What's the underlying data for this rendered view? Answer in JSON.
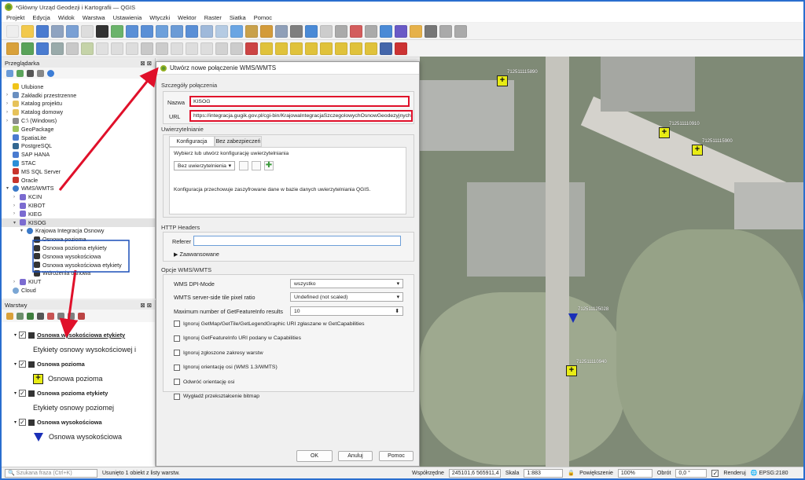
{
  "window": {
    "title": "*Główny Urząd Geodezji i Kartografii — QGIS"
  },
  "menu": [
    "Projekt",
    "Edycja",
    "Widok",
    "Warstwa",
    "Ustawienia",
    "Wtyczki",
    "Wektor",
    "Raster",
    "Siatka",
    "Pomoc"
  ],
  "browser": {
    "title": "Przeglądarka",
    "items": [
      {
        "label": "Ulubione",
        "icon": "star-icon",
        "indent": 0
      },
      {
        "label": "Zakładki przestrzenne",
        "icon": "bookmark-icon",
        "indent": 0
      },
      {
        "label": "Katalog projektu",
        "icon": "folder-icon",
        "indent": 0
      },
      {
        "label": "Katalog domowy",
        "icon": "folder-icon",
        "indent": 0
      },
      {
        "label": "C:\\ (Windows)",
        "icon": "drive-icon",
        "indent": 0
      },
      {
        "label": "GeoPackage",
        "icon": "geopackage-icon",
        "indent": 0
      },
      {
        "label": "SpatiaLite",
        "icon": "spatialite-icon",
        "indent": 0
      },
      {
        "label": "PostgreSQL",
        "icon": "postgresql-icon",
        "indent": 0
      },
      {
        "label": "SAP HANA",
        "icon": "database-icon",
        "indent": 0
      },
      {
        "label": "STAC",
        "icon": "stac-icon",
        "indent": 0
      },
      {
        "label": "MS SQL Server",
        "icon": "mssql-icon",
        "indent": 0
      },
      {
        "label": "Oracle",
        "icon": "oracle-icon",
        "indent": 0
      },
      {
        "label": "WMS/WMTS",
        "icon": "globe-icon",
        "indent": 0
      },
      {
        "label": "KCIN",
        "icon": "wms-connection-icon",
        "indent": 1
      },
      {
        "label": "KIBOT",
        "icon": "wms-connection-icon",
        "indent": 1
      },
      {
        "label": "KIEG",
        "icon": "wms-connection-icon",
        "indent": 1
      },
      {
        "label": "KISOG",
        "icon": "wms-connection-icon",
        "indent": 1
      },
      {
        "label": "Krajowa Integracja Osnowy",
        "icon": "globe-icon",
        "indent": 2
      },
      {
        "label": "Osnowa pozioma",
        "icon": "layer-icon",
        "indent": 3
      },
      {
        "label": "Osnowa pozioma etykiety",
        "icon": "layer-icon",
        "indent": 3
      },
      {
        "label": "Osnowa wysokościowa",
        "icon": "layer-icon",
        "indent": 3
      },
      {
        "label": "Osnowa wysokościowa etykiety",
        "icon": "layer-icon",
        "indent": 3
      },
      {
        "label": "Wdrożenia osnowa",
        "icon": "layer-icon",
        "indent": 3
      },
      {
        "label": "KIUT",
        "icon": "wms-connection-icon",
        "indent": 1
      },
      {
        "label": "Cloud",
        "icon": "cloud-icon",
        "indent": 0
      }
    ]
  },
  "layers": {
    "title": "Warstwy",
    "items": [
      {
        "name": "Osnowa wysokościowa etykiety",
        "legend": "Etykiety osnowy wysokościowej i",
        "symbol": "none"
      },
      {
        "name": "Osnowa pozioma",
        "legend": "Osnowa pozioma",
        "symbol": "yellow-square"
      },
      {
        "name": "Osnowa pozioma etykiety",
        "legend": "Etykiety osnowy poziomej",
        "symbol": "none"
      },
      {
        "name": "Osnowa wysokościowa",
        "legend": "Osnowa wysokościowa",
        "symbol": "blue-triangle"
      }
    ]
  },
  "dialog": {
    "title": "Utwórz nowe połączenie WMS/WMTS",
    "section_connection": "Szczegóły połączenia",
    "name_label": "Nazwa",
    "name_value": "KISOG",
    "url_label": "URL",
    "url_value": "https://integracja.gugik.gov.pl/cgi-bin/KrajowaIntegracjaSzczegolowychOsnowGeodezyjnych",
    "auth_section": "Uwierzytelnianie",
    "tab_config": "Konfiguracja",
    "tab_none": "Bez zabezpieczeń",
    "auth_prompt": "Wybierz lub utwórz konfigurację uwierzytelniania",
    "auth_combo": "Bez uwierzytelnienia",
    "auth_note": "Konfiguracja przechowuje zaszyfrowane dane w bazie danych uwierzytelniania QGIS.",
    "http_section": "HTTP Headers",
    "referer_label": "Referer",
    "advanced_label": "Zaawansowane",
    "options_section": "Opcje WMS/WMTS",
    "dpi_label": "WMS DPI-Mode",
    "dpi_value": "wszystko",
    "tile_label": "WMTS server-side tile pixel ratio",
    "tile_value": "Undefined (not scaled)",
    "maxfeat_label": "Maximum number of GetFeatureInfo results",
    "maxfeat_value": "10",
    "checkboxes": [
      "Ignoruj GetMap/GetTile/GetLegendGraphic URI zgłaszane w GetCapabilities",
      "Ignoruj GetFeatureInfo URI podany w Capabilities",
      "Ignoruj zgłoszone zakresy warstw",
      "Ignoruj orientację osi (WMS 1.3/WMTS)",
      "Odwróć orientację osi",
      "Wygładź przekształcenie bitmap"
    ],
    "ok": "OK",
    "cancel": "Anuluj",
    "help": "Pomoc"
  },
  "map_points": [
    {
      "label": "712511115890",
      "type": "square"
    },
    {
      "label": "712511110910",
      "type": "square"
    },
    {
      "label": "712511115900",
      "type": "square"
    },
    {
      "label": "712511125028",
      "type": "triangle"
    },
    {
      "label": "712511110940",
      "type": "square"
    }
  ],
  "status": {
    "search_placeholder": "Szukana fraza (Ctrl+K)",
    "message": "Usunięto 1 obiekt z listy warstw.",
    "coord_label": "Współrzędne",
    "coord_value": "245101,6  565911,4",
    "scale_label": "Skala",
    "scale_value": "1:883",
    "mag_label": "Powiększenie",
    "mag_value": "100%",
    "rot_label": "Obrót",
    "rot_value": "0,0 °",
    "render_label": "Renderuj",
    "crs": "EPSG:2180"
  },
  "colors": {
    "accent_red": "#e0102a",
    "selection_blue": "#1a4fb8",
    "marker_yellow": "#e8ec15"
  }
}
